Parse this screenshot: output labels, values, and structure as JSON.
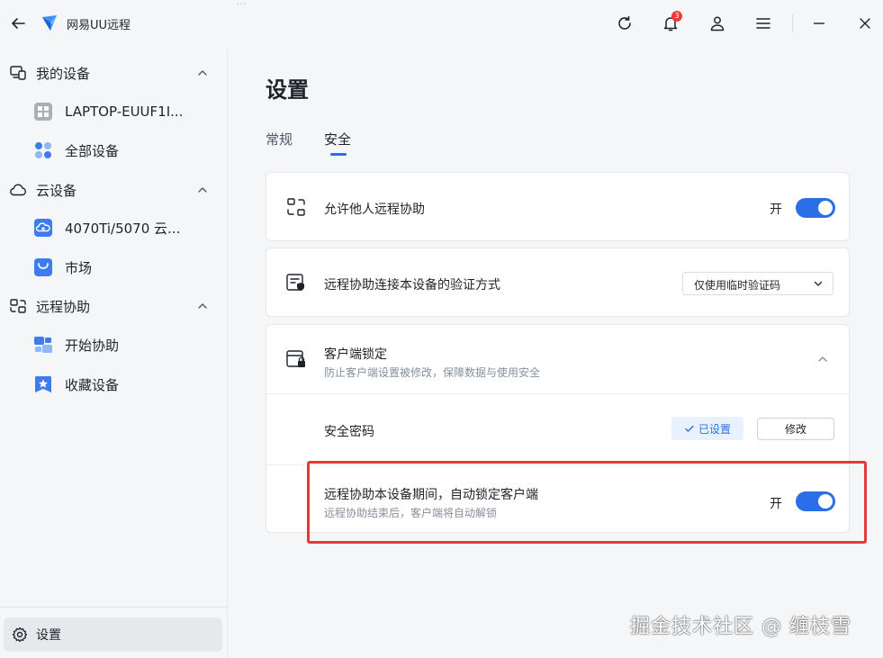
{
  "titlebar": {
    "app_title": "网易UU远程",
    "top_text": "…",
    "notification_count": "3",
    "icons": [
      "back-arrow-icon",
      "app-logo-icon",
      "refresh-icon",
      "bell-icon",
      "user-icon",
      "menu-icon",
      "minimize-icon",
      "close-icon"
    ]
  },
  "sidebar": {
    "my_devices": {
      "label": "我的设备",
      "items": [
        {
          "label": "LAPTOP-EUUF1I...",
          "icon": "windows-icon"
        },
        {
          "label": "全部设备",
          "icon": "dots-grid-icon"
        }
      ]
    },
    "cloud_devices": {
      "label": "云设备",
      "items": [
        {
          "label": "4070Ti/5070 云...",
          "icon": "cloud-pc-icon"
        },
        {
          "label": "市场",
          "icon": "bag-icon"
        }
      ]
    },
    "remote_assist": {
      "label": "远程协助",
      "items": [
        {
          "label": "开始协助",
          "icon": "assist-icon"
        },
        {
          "label": "收藏设备",
          "icon": "star-icon"
        }
      ]
    },
    "settings_label": "设置"
  },
  "main": {
    "title": "设置",
    "tabs": [
      {
        "label": "常规",
        "active": false
      },
      {
        "label": "安全",
        "active": true
      }
    ],
    "allow_remote": {
      "title": "允许他人远程协助",
      "state_label": "开",
      "enabled": true
    },
    "verify_method": {
      "title": "远程协助连接本设备的验证方式",
      "selected": "仅使用临时验证码"
    },
    "client_lock": {
      "title": "客户端锁定",
      "subtitle": "防止客户端设置被修改，保障数据与使用安全",
      "password": {
        "title": "安全密码",
        "status": "已设置",
        "modify_label": "修改"
      },
      "auto_lock": {
        "title": "远程协助本设备期间，自动锁定客户端",
        "subtitle": "远程协助结束后，客户端将自动解锁",
        "state_label": "开",
        "enabled": true
      }
    }
  },
  "watermark": "掘金技术社区 @ 缠枝雪",
  "colors": {
    "accent": "#2b6fe8",
    "highlight": "#e53935",
    "badge": "#f23a3c"
  }
}
